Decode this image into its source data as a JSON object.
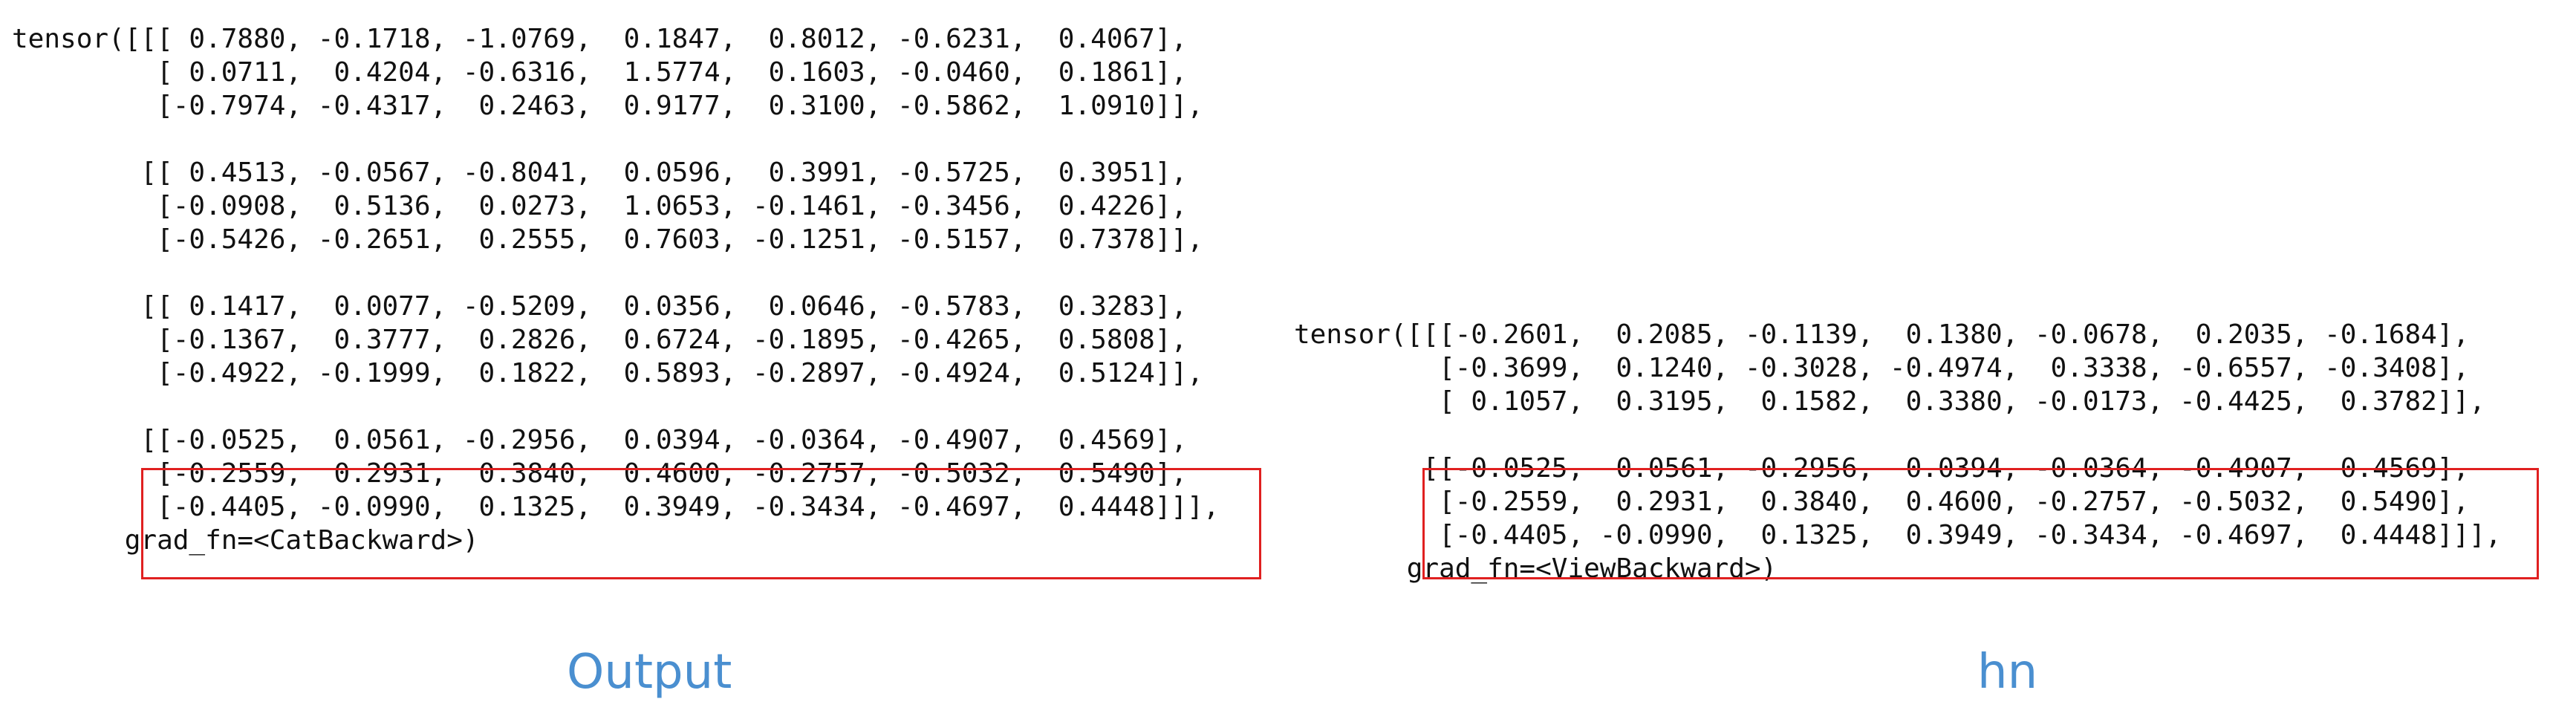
{
  "left_panel": {
    "lines": [
      "tensor([[[ 0.7880, -0.1718, -1.0769,  0.1847,  0.8012, -0.6231,  0.4067],",
      "         [ 0.0711,  0.4204, -0.6316,  1.5774,  0.1603, -0.0460,  0.1861],",
      "         [-0.7974, -0.4317,  0.2463,  0.9177,  0.3100, -0.5862,  1.0910]],",
      "",
      "        [[ 0.4513, -0.0567, -0.8041,  0.0596,  0.3991, -0.5725,  0.3951],",
      "         [-0.0908,  0.5136,  0.0273,  1.0653, -0.1461, -0.3456,  0.4226],",
      "         [-0.5426, -0.2651,  0.2555,  0.7603, -0.1251, -0.5157,  0.7378]],",
      "",
      "        [[ 0.1417,  0.0077, -0.5209,  0.0356,  0.0646, -0.5783,  0.3283],",
      "         [-0.1367,  0.3777,  0.2826,  0.6724, -0.1895, -0.4265,  0.5808],",
      "         [-0.4922, -0.1999,  0.1822,  0.5893, -0.2897, -0.4924,  0.5124]],",
      "",
      "        [[-0.0525,  0.0561, -0.2956,  0.0394, -0.0364, -0.4907,  0.4569],",
      "         [-0.2559,  0.2931,  0.3840,  0.4600, -0.2757, -0.5032,  0.5490],",
      "         [-0.4405, -0.0990,  0.1325,  0.3949, -0.3434, -0.4697,  0.4448]]],",
      "       grad_fn=<CatBackward>)"
    ],
    "caption": "Output"
  },
  "right_panel": {
    "lines": [
      "tensor([[[-0.2601,  0.2085, -0.1139,  0.1380, -0.0678,  0.2035, -0.1684],",
      "         [-0.3699,  0.1240, -0.3028, -0.4974,  0.3338, -0.6557, -0.3408],",
      "         [ 0.1057,  0.3195,  0.1582,  0.3380, -0.0173, -0.4425,  0.3782]],",
      "",
      "        [[-0.0525,  0.0561, -0.2956,  0.0394, -0.0364, -0.4907,  0.4569],",
      "         [-0.2559,  0.2931,  0.3840,  0.4600, -0.2757, -0.5032,  0.5490],",
      "         [-0.4405, -0.0990,  0.1325,  0.3949, -0.3434, -0.4697,  0.4448]]],",
      "       grad_fn=<ViewBackward>)"
    ],
    "caption": "hn"
  },
  "colors": {
    "text": "#111111",
    "highlight_box": "#e02020",
    "caption": "#4a8fd0",
    "background": "#ffffff"
  }
}
